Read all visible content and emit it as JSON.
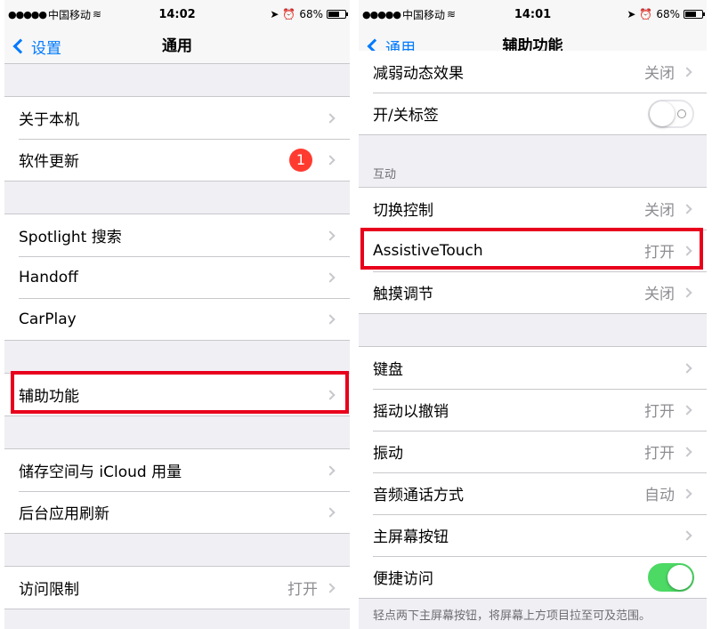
{
  "left": {
    "status": {
      "carrier": "中国移动",
      "time": "14:02",
      "battery": "68%"
    },
    "nav": {
      "back_label": "设置",
      "title": "通用"
    },
    "groups": [
      [
        {
          "label": "关于本机"
        },
        {
          "label": "软件更新",
          "badge": "1"
        }
      ],
      [
        {
          "label": "Spotlight 搜索"
        },
        {
          "label": "Handoff"
        },
        {
          "label": "CarPlay"
        }
      ],
      [
        {
          "label": "辅助功能"
        }
      ],
      [
        {
          "label": "储存空间与 iCloud 用量"
        },
        {
          "label": "后台应用刷新"
        }
      ],
      [
        {
          "label": "访问限制",
          "value": "打开"
        }
      ]
    ]
  },
  "right": {
    "status": {
      "carrier": "中国移动",
      "time": "14:01",
      "battery": "68%"
    },
    "nav": {
      "back_label": "通用",
      "title": "辅助功能"
    },
    "top_rows": [
      {
        "label": "减弱动态效果",
        "value": "关闭"
      },
      {
        "label": "开/关标签",
        "toggle": "off"
      }
    ],
    "interaction_header": "互动",
    "interaction_rows": [
      {
        "label": "切换控制",
        "value": "关闭"
      },
      {
        "label": "AssistiveTouch",
        "value": "打开"
      },
      {
        "label": "触摸调节",
        "value": "关闭"
      }
    ],
    "bottom_rows": [
      {
        "label": "键盘"
      },
      {
        "label": "摇动以撤销",
        "value": "打开"
      },
      {
        "label": "振动",
        "value": "打开"
      },
      {
        "label": "音频通话方式",
        "value": "自动"
      },
      {
        "label": "主屏幕按钮"
      },
      {
        "label": "便捷访问",
        "toggle": "on"
      }
    ],
    "footer": "轻点两下主屏幕按钮，将屏幕上方项目拉至可及范围。"
  },
  "colors": {
    "accent": "#007aff",
    "badge": "#ff3b30",
    "toggle_on": "#4cd964",
    "highlight": "#e8001c"
  }
}
